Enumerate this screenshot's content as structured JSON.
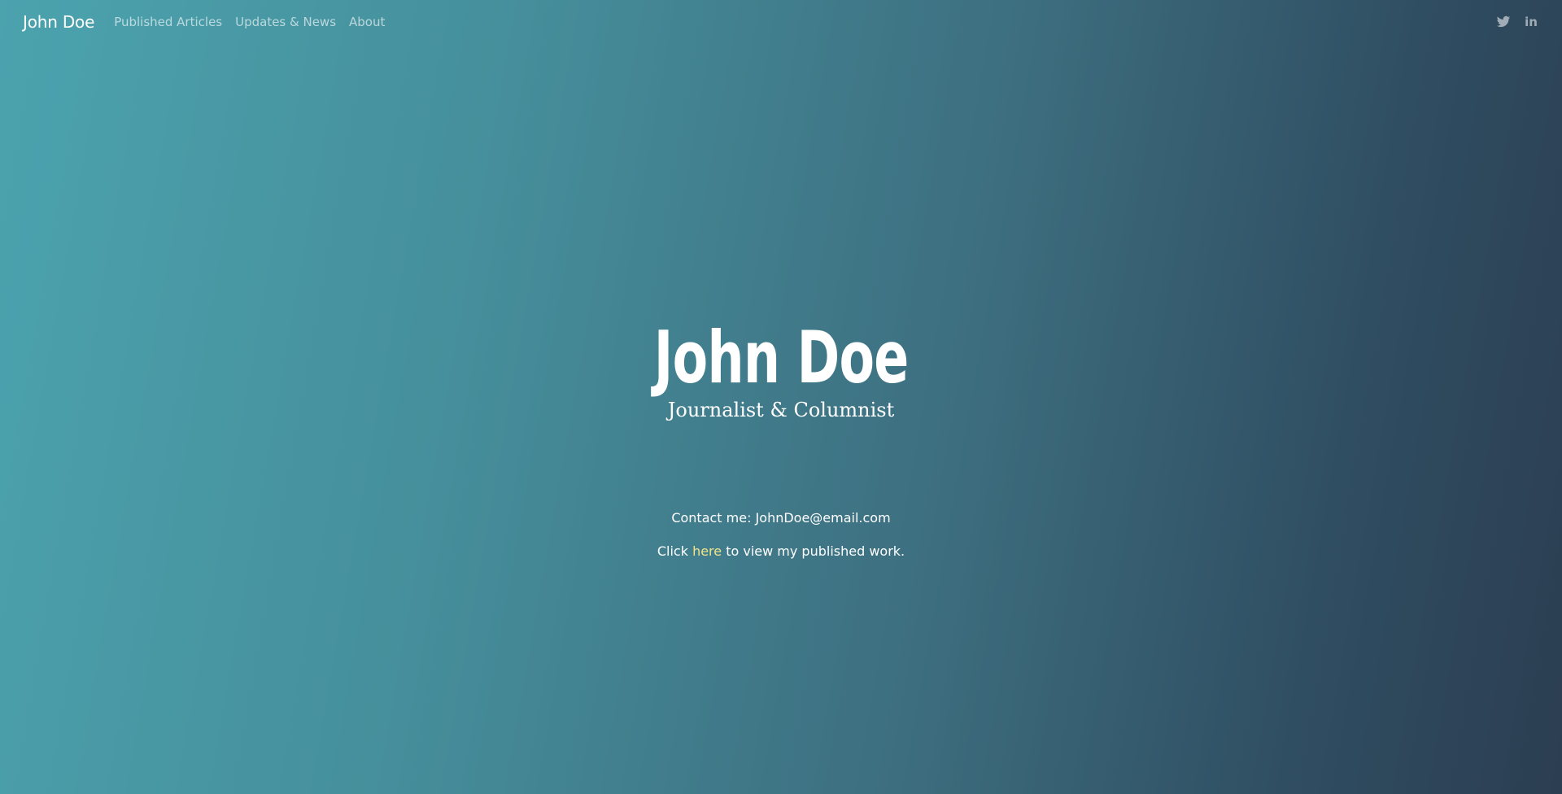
{
  "navbar": {
    "brand": "John Doe",
    "links": [
      "Published Articles",
      "Updates & News",
      "About"
    ],
    "social": [
      "twitter-icon",
      "linkedin-icon"
    ],
    "linkedin_text": "in"
  },
  "hero": {
    "title": "John Doe",
    "subtitle": "Journalist & Columnist"
  },
  "contact": {
    "contact_line": "Contact me: JohnDoe@email.com",
    "click_prefix": "Click ",
    "here_link": "here",
    "click_suffix": " to view my published work."
  },
  "colors": {
    "gradient_start": "#4ba3ae",
    "gradient_end": "#2c3e52",
    "link_accent": "#f0e48c"
  }
}
